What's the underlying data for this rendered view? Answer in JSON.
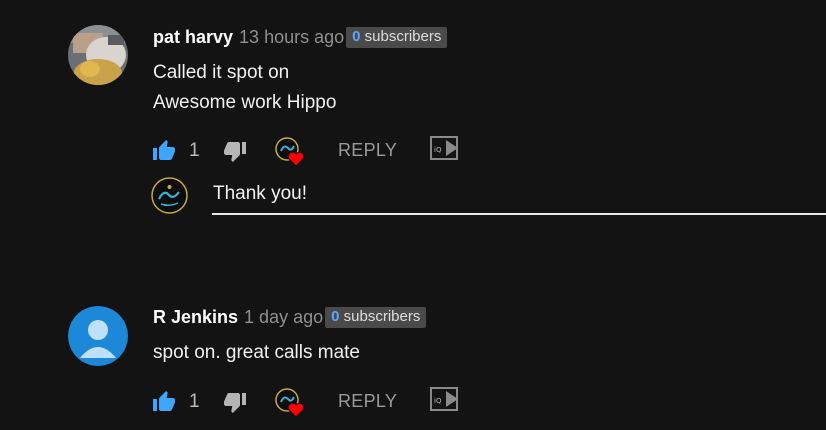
{
  "comments": [
    {
      "author": "pat harvy",
      "time": "13 hours ago",
      "subscribers_count": "0",
      "subscribers_label": " subscribers",
      "lines": [
        "Called it spot on",
        "Awesome work Hippo"
      ],
      "like_count": "1",
      "reply_label": "REPLY",
      "avatar_icon": "photo-avatar"
    },
    {
      "author": "R Jenkins",
      "time": "1 day ago",
      "subscribers_count": "0",
      "subscribers_label": " subscribers",
      "lines": [
        "spot on. great calls mate"
      ],
      "like_count": "1",
      "reply_label": "REPLY",
      "avatar_icon": "default-user-icon"
    }
  ],
  "reply_box": {
    "value": "Thank you!",
    "avatar_icon": "channel-logo"
  },
  "colors": {
    "background": "#131313",
    "like_blue": "#3ea6ff",
    "subs_number": "#5ea4ff",
    "heart_red": "#ff0000",
    "default_avatar": "#1e88d8"
  }
}
